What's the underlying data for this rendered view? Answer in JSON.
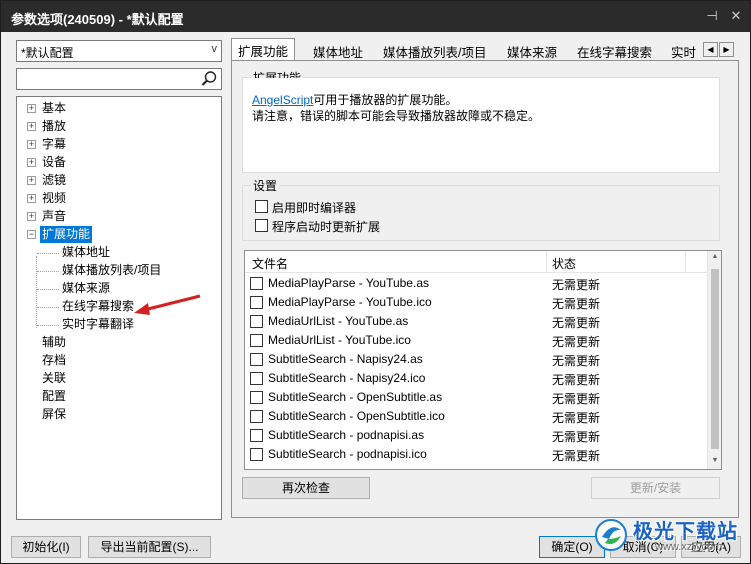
{
  "window": {
    "title": "参数选项(240509) - *默认配置",
    "pin_glyph": "⊣",
    "close_glyph": "✕"
  },
  "left": {
    "profile_value": "*默认配置",
    "combo_arrow": "v",
    "search_placeholder": "",
    "tree": [
      {
        "label": "基本",
        "expander": "+"
      },
      {
        "label": "播放",
        "expander": "+"
      },
      {
        "label": "字幕",
        "expander": "+"
      },
      {
        "label": "设备",
        "expander": "+"
      },
      {
        "label": "滤镜",
        "expander": "+"
      },
      {
        "label": "视频",
        "expander": "+"
      },
      {
        "label": "声音",
        "expander": "+"
      },
      {
        "label": "扩展功能",
        "expander": "−",
        "selected": true
      },
      {
        "label": "媒体地址"
      },
      {
        "label": "媒体播放列表/项目"
      },
      {
        "label": "媒体来源"
      },
      {
        "label": "在线字幕搜索"
      },
      {
        "label": "实时字幕翻译"
      },
      {
        "label": "辅助"
      },
      {
        "label": "存档"
      },
      {
        "label": "关联"
      },
      {
        "label": "配置"
      },
      {
        "label": "屏保"
      }
    ]
  },
  "tabs": {
    "items": [
      "扩展功能",
      "媒体地址",
      "媒体播放列表/项目",
      "媒体来源",
      "在线字幕搜索",
      "实时"
    ],
    "active": "扩展功能",
    "scroll_left": "◀",
    "scroll_right": "▶"
  },
  "extension_group": {
    "caption": "扩展功能",
    "link": "AngelScript",
    "line1_rest": "可用于播放器的扩展功能。",
    "line2": "请注意，错误的脚本可能会导致播放器故障或不稳定。"
  },
  "settings_group": {
    "caption": "设置",
    "options": [
      "启用即时编译器",
      "程序启动时更新扩展"
    ]
  },
  "file_list": {
    "col_name": "文件名",
    "col_status": "状态",
    "rows": [
      {
        "name": "MediaPlayParse - YouTube.as",
        "status": "无需更新"
      },
      {
        "name": "MediaPlayParse - YouTube.ico",
        "status": "无需更新"
      },
      {
        "name": "MediaUrlList - YouTube.as",
        "status": "无需更新"
      },
      {
        "name": "MediaUrlList - YouTube.ico",
        "status": "无需更新"
      },
      {
        "name": "SubtitleSearch - Napisy24.as",
        "status": "无需更新"
      },
      {
        "name": "SubtitleSearch - Napisy24.ico",
        "status": "无需更新"
      },
      {
        "name": "SubtitleSearch - OpenSubtitle.as",
        "status": "无需更新"
      },
      {
        "name": "SubtitleSearch - OpenSubtitle.ico",
        "status": "无需更新"
      },
      {
        "name": "SubtitleSearch - podnapisi.as",
        "status": "无需更新"
      },
      {
        "name": "SubtitleSearch - podnapisi.ico",
        "status": "无需更新"
      }
    ],
    "scroll_up": "▲",
    "scroll_down": "▼"
  },
  "buttons": {
    "recheck": "再次检查",
    "update_install": "更新/安装",
    "initialize": "初始化(I)",
    "export": "导出当前配置(S)...",
    "ok": "确定(O)",
    "cancel": "取消(C)",
    "apply": "应用(A)"
  },
  "watermark": {
    "brand": "极光下载站",
    "url": "www.xz7.com"
  },
  "colors": {
    "title_bar": "#2b2b2b",
    "selection": "#0078d7",
    "link": "#0066cc",
    "annotation_arrow": "#d42020"
  }
}
